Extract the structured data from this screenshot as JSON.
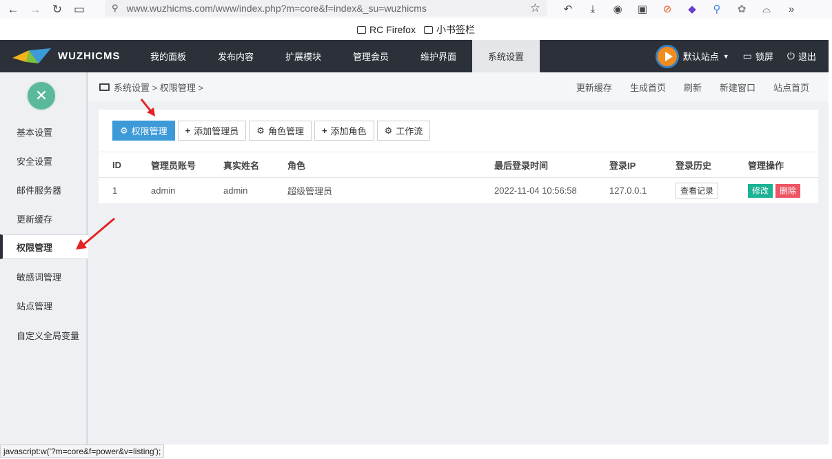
{
  "browser": {
    "url": "www.wuzhicms.com/www/index.php?m=core&f=index&_su=wuzhicms",
    "bookmarks": [
      "RC Firefox",
      "小书签栏"
    ],
    "status_text": "javascript:w('?m=core&f=power&v=listing');"
  },
  "header": {
    "logo_text": "WUZHICMS",
    "nav": [
      "我的面板",
      "发布内容",
      "扩展模块",
      "管理会员",
      "维护界面",
      "系统设置"
    ],
    "active_nav": "系统设置",
    "site_label": "默认站点",
    "lock_label": "锁屏",
    "logout_label": "退出"
  },
  "sidebar": {
    "items": [
      "基本设置",
      "安全设置",
      "邮件服务器",
      "更新缓存",
      "权限管理",
      "敏感词管理",
      "站点管理",
      "自定义全局变量"
    ],
    "active": "权限管理"
  },
  "breadcrumb": {
    "text": "系统设置 > 权限管理 >",
    "actions": [
      "更新缓存",
      "生成首页",
      "刷新",
      "新建窗口",
      "站点首页"
    ]
  },
  "toolbar": {
    "buttons": [
      "权限管理",
      "添加管理员",
      "角色管理",
      "添加角色",
      "工作流"
    ]
  },
  "table": {
    "headers": [
      "ID",
      "管理员账号",
      "真实姓名",
      "角色",
      "最后登录时间",
      "登录IP",
      "登录历史",
      "管理操作"
    ],
    "rows": [
      {
        "id": "1",
        "account": "admin",
        "realname": "admin",
        "role": "超级管理员",
        "last_login": "2022-11-04 10:56:58",
        "ip": "127.0.0.1",
        "history_btn": "查看记录",
        "edit_btn": "修改",
        "delete_btn": "删除"
      }
    ]
  },
  "colors": {
    "header_bg": "#2b3039",
    "primary": "#3c9ad8",
    "edit": "#1bb394",
    "delete": "#ed5565",
    "annotation": "#e52222"
  }
}
